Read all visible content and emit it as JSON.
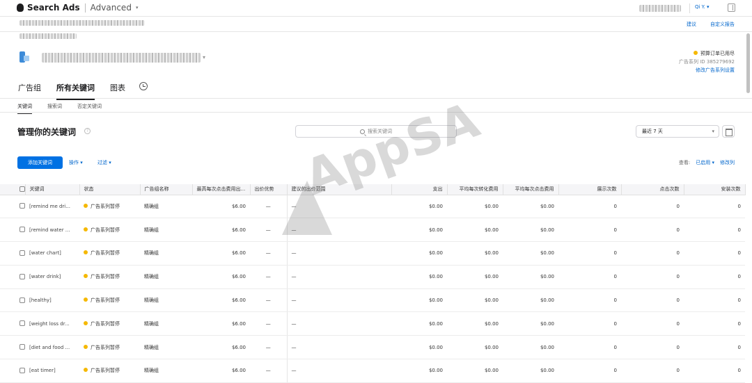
{
  "topbar": {
    "brand": "Search Ads",
    "mode": "Advanced",
    "org": "Qi Y."
  },
  "header_links": [
    "建议",
    "自定义报告"
  ],
  "campaign": {
    "status": "预算订单已用尽",
    "id_label": "广告系列 ID 385279692",
    "settings_link": "修改广告系列设置"
  },
  "tabs": [
    "广告组",
    "所有关键词",
    "图表"
  ],
  "subtabs": [
    "关键词",
    "搜索词",
    "否定关键词"
  ],
  "main": {
    "title": "管理你的关键词",
    "search_placeholder": "搜索关键词",
    "date_range": "最近 7 天",
    "add_button": "添加关键词",
    "actions": "操作",
    "filter": "过滤",
    "view_label": "查看:",
    "view_value": "已启用",
    "edit_columns": "修改列"
  },
  "watermark": "AppSA",
  "table": {
    "columns": [
      "关键词",
      "状态",
      "广告组名称",
      "最高每次点击费用出...",
      "出价优势",
      "建议的出价范围",
      "支出",
      "平均每次转化费用",
      "平均每次点击费用",
      "展示次数",
      "点击次数",
      "安装次数"
    ],
    "rows": [
      {
        "keyword": "[remind me dri...",
        "status": "广告系列暂停",
        "adgroup": "精确组",
        "maxcpt": "$6.00",
        "strength": "—",
        "range": "—",
        "spend": "$0.00",
        "cpa": "$0.00",
        "cpt": "$0.00",
        "impr": "0",
        "taps": "0",
        "installs": "0"
      },
      {
        "keyword": "[remind water ...",
        "status": "广告系列暂停",
        "adgroup": "精确组",
        "maxcpt": "$6.00",
        "strength": "—",
        "range": "—",
        "spend": "$0.00",
        "cpa": "$0.00",
        "cpt": "$0.00",
        "impr": "0",
        "taps": "0",
        "installs": "0"
      },
      {
        "keyword": "[water chart]",
        "status": "广告系列暂停",
        "adgroup": "精确组",
        "maxcpt": "$6.00",
        "strength": "—",
        "range": "—",
        "spend": "$0.00",
        "cpa": "$0.00",
        "cpt": "$0.00",
        "impr": "0",
        "taps": "0",
        "installs": "0"
      },
      {
        "keyword": "[water drink]",
        "status": "广告系列暂停",
        "adgroup": "精确组",
        "maxcpt": "$6.00",
        "strength": "—",
        "range": "—",
        "spend": "$0.00",
        "cpa": "$0.00",
        "cpt": "$0.00",
        "impr": "0",
        "taps": "0",
        "installs": "0"
      },
      {
        "keyword": "[healthy]",
        "status": "广告系列暂停",
        "adgroup": "精确组",
        "maxcpt": "$6.00",
        "strength": "—",
        "range": "—",
        "spend": "$0.00",
        "cpa": "$0.00",
        "cpt": "$0.00",
        "impr": "0",
        "taps": "0",
        "installs": "0"
      },
      {
        "keyword": "[weight loss dr...",
        "status": "广告系列暂停",
        "adgroup": "精确组",
        "maxcpt": "$6.00",
        "strength": "—",
        "range": "—",
        "spend": "$0.00",
        "cpa": "$0.00",
        "cpt": "$0.00",
        "impr": "0",
        "taps": "0",
        "installs": "0"
      },
      {
        "keyword": "[diet and food ...",
        "status": "广告系列暂停",
        "adgroup": "精确组",
        "maxcpt": "$6.00",
        "strength": "—",
        "range": "—",
        "spend": "$0.00",
        "cpa": "$0.00",
        "cpt": "$0.00",
        "impr": "0",
        "taps": "0",
        "installs": "0"
      },
      {
        "keyword": "[eat timer]",
        "status": "广告系列暂停",
        "adgroup": "精确组",
        "maxcpt": "$6.00",
        "strength": "—",
        "range": "—",
        "spend": "$0.00",
        "cpa": "$0.00",
        "cpt": "$0.00",
        "impr": "0",
        "taps": "0",
        "installs": "0"
      }
    ]
  }
}
